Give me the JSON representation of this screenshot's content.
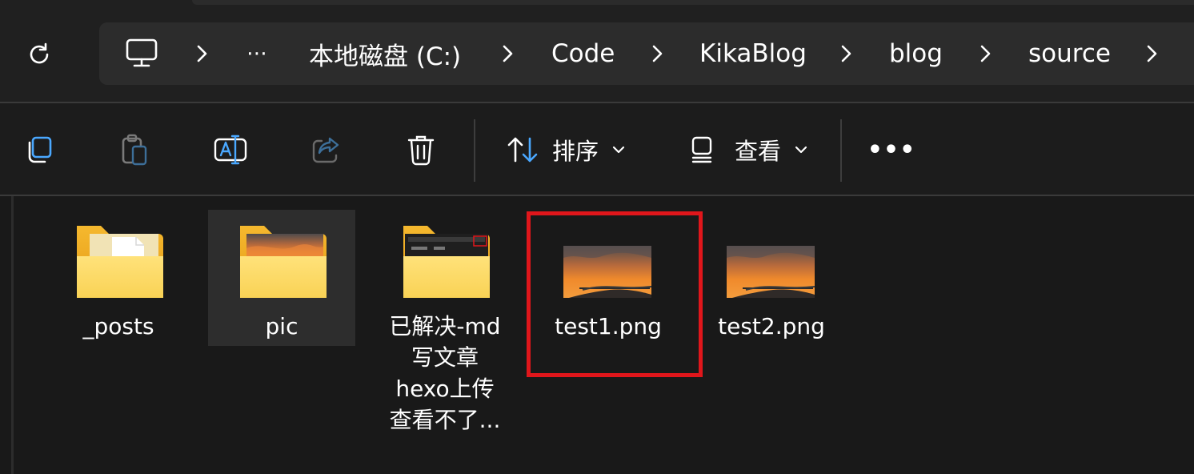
{
  "address_bar": {
    "breadcrumbs": [
      "本地磁盘 (C:)",
      "Code",
      "KikaBlog",
      "blog",
      "source"
    ],
    "overflow_label": "⋯",
    "icons": [
      "refresh-icon",
      "computer-icon",
      "chevron-right-icon"
    ]
  },
  "toolbar": {
    "sort_label": "排序",
    "view_label": "查看",
    "more_label": "•••",
    "icons": [
      "copy-icon",
      "paste-icon",
      "rename-icon",
      "share-icon",
      "delete-icon",
      "sort-icon",
      "view-icon",
      "more-icon"
    ]
  },
  "files": [
    {
      "name": "_posts",
      "type": "folder"
    },
    {
      "name": "pic",
      "type": "folder",
      "selected": true
    },
    {
      "name": "已解决-md\n写文章\nhexo上传\n查看不了...",
      "type": "folder"
    },
    {
      "name": "test1.png",
      "type": "image",
      "highlighted": true
    },
    {
      "name": "test2.png",
      "type": "image"
    }
  ],
  "colors": {
    "background": "#191919",
    "address_bar": "#2c2c2c",
    "highlight_border": "#e0161b",
    "folder_yellow": "#f7c948",
    "accent_blue": "#4aa8ff"
  }
}
